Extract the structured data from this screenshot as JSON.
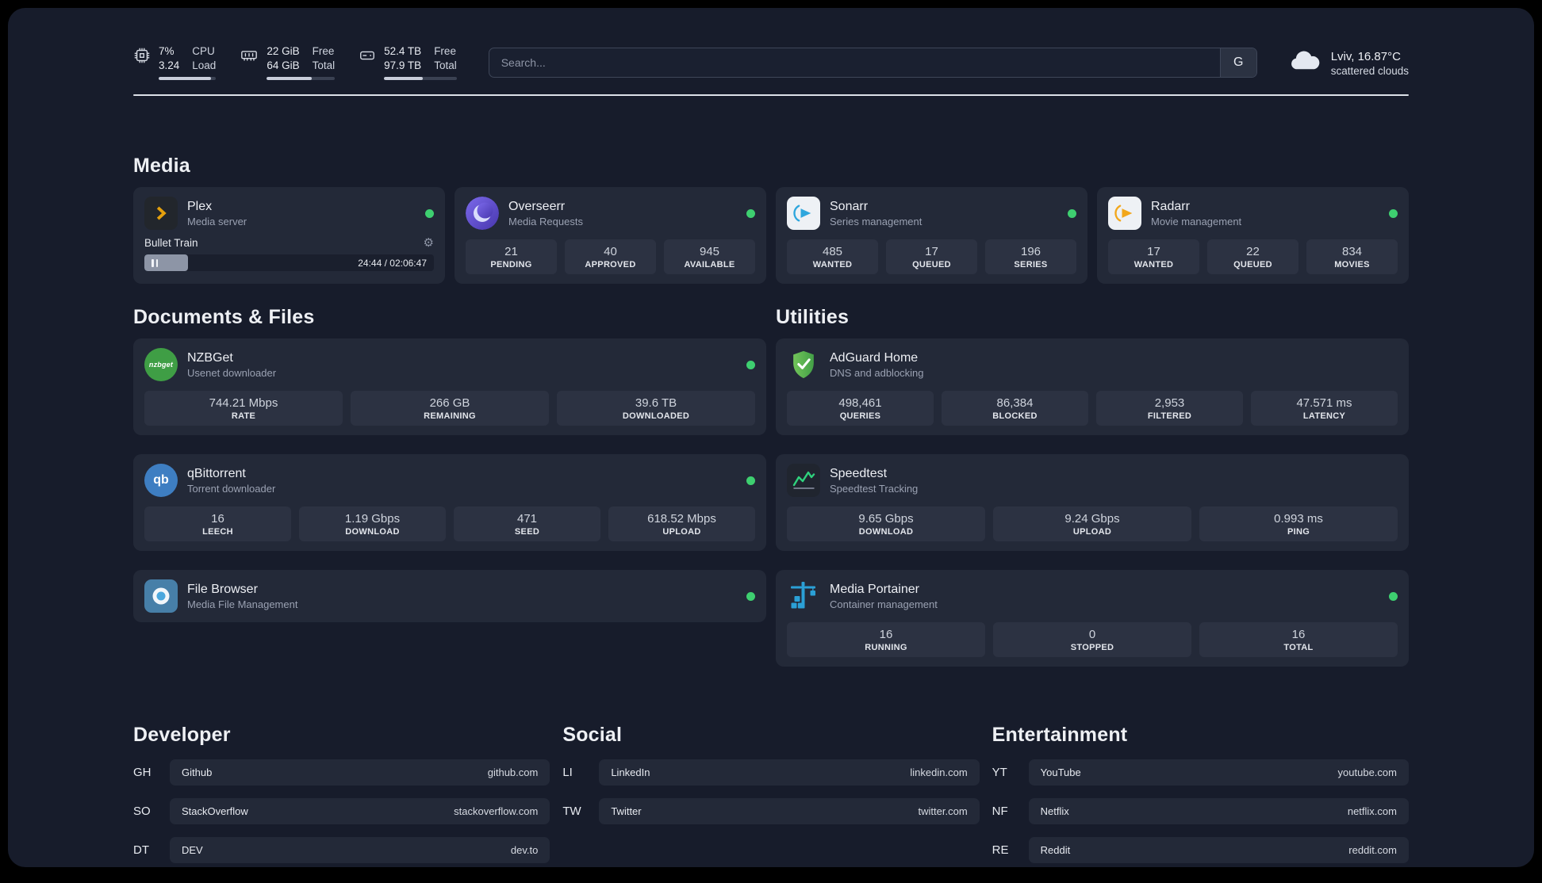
{
  "colors": {
    "status_online": "#3ecf70",
    "plex_gold": "#e5a00d",
    "sonarr_blue": "#2ea6dd",
    "radarr_amber": "#f2a71c",
    "nzbget_green": "#3f9e45",
    "qbittorrent_blue": "#3e7ec2",
    "adguard_green": "#57b85c",
    "speedtest_green": "#2fd27d",
    "portainer_blue": "#2ba0d6",
    "page_background": "#171c2b"
  },
  "icons": {
    "gear": "⚙",
    "nzbget_text": "nzbget",
    "qbittorrent_text": "qb"
  },
  "header": {
    "cpu": {
      "value_top": "7%",
      "value_bottom": "3.24",
      "label_top": "CPU",
      "label_bottom": "Load",
      "progress": 91
    },
    "ram": {
      "value_top": "22 GiB",
      "value_bottom": "64 GiB",
      "label_top": "Free",
      "label_bottom": "Total",
      "progress": 66
    },
    "disk": {
      "value_top": "52.4 TB",
      "value_bottom": "97.9 TB",
      "label_top": "Free",
      "label_bottom": "Total",
      "progress": 53
    },
    "search": {
      "placeholder": "Search...",
      "engine_button": "G"
    },
    "weather": {
      "location": "Lviv, 16.87°C",
      "condition": "scattered clouds"
    }
  },
  "media": {
    "title": "Media",
    "plex": {
      "name": "Plex",
      "desc": "Media server",
      "player": {
        "title": "Bullet Train",
        "time": "24:44 / 02:06:47",
        "progress": 15
      }
    },
    "overseerr": {
      "name": "Overseerr",
      "desc": "Media Requests",
      "stats": [
        {
          "value": "21",
          "label": "PENDING"
        },
        {
          "value": "40",
          "label": "APPROVED"
        },
        {
          "value": "945",
          "label": "AVAILABLE"
        }
      ]
    },
    "sonarr": {
      "name": "Sonarr",
      "desc": "Series management",
      "stats": [
        {
          "value": "485",
          "label": "WANTED"
        },
        {
          "value": "17",
          "label": "QUEUED"
        },
        {
          "value": "196",
          "label": "SERIES"
        }
      ]
    },
    "radarr": {
      "name": "Radarr",
      "desc": "Movie management",
      "stats": [
        {
          "value": "17",
          "label": "WANTED"
        },
        {
          "value": "22",
          "label": "QUEUED"
        },
        {
          "value": "834",
          "label": "MOVIES"
        }
      ]
    }
  },
  "documents": {
    "title": "Documents & Files",
    "nzbget": {
      "name": "NZBGet",
      "desc": "Usenet downloader",
      "stats": [
        {
          "value": "744.21 Mbps",
          "label": "RATE"
        },
        {
          "value": "266 GB",
          "label": "REMAINING"
        },
        {
          "value": "39.6 TB",
          "label": "DOWNLOADED"
        }
      ]
    },
    "qbittorrent": {
      "name": "qBittorrent",
      "desc": "Torrent downloader",
      "stats": [
        {
          "value": "16",
          "label": "LEECH"
        },
        {
          "value": "1.19 Gbps",
          "label": "DOWNLOAD"
        },
        {
          "value": "471",
          "label": "SEED"
        },
        {
          "value": "618.52 Mbps",
          "label": "UPLOAD"
        }
      ]
    },
    "filebrowser": {
      "name": "File Browser",
      "desc": "Media File Management"
    }
  },
  "utilities": {
    "title": "Utilities",
    "adguard": {
      "name": "AdGuard Home",
      "desc": "DNS and adblocking",
      "stats": [
        {
          "value": "498,461",
          "label": "QUERIES"
        },
        {
          "value": "86,384",
          "label": "BLOCKED"
        },
        {
          "value": "2,953",
          "label": "FILTERED"
        },
        {
          "value": "47.571 ms",
          "label": "LATENCY"
        }
      ]
    },
    "speedtest": {
      "name": "Speedtest",
      "desc": "Speedtest Tracking",
      "stats": [
        {
          "value": "9.65 Gbps",
          "label": "DOWNLOAD"
        },
        {
          "value": "9.24 Gbps",
          "label": "UPLOAD"
        },
        {
          "value": "0.993 ms",
          "label": "PING"
        }
      ]
    },
    "portainer": {
      "name": "Media Portainer",
      "desc": "Container management",
      "stats": [
        {
          "value": "16",
          "label": "RUNNING"
        },
        {
          "value": "0",
          "label": "STOPPED"
        },
        {
          "value": "16",
          "label": "TOTAL"
        }
      ]
    }
  },
  "bookmarks": {
    "developer": {
      "title": "Developer",
      "items": [
        {
          "abbr": "GH",
          "name": "Github",
          "url": "github.com"
        },
        {
          "abbr": "SO",
          "name": "StackOverflow",
          "url": "stackoverflow.com"
        },
        {
          "abbr": "DT",
          "name": "DEV",
          "url": "dev.to"
        }
      ]
    },
    "social": {
      "title": "Social",
      "items": [
        {
          "abbr": "LI",
          "name": "LinkedIn",
          "url": "linkedin.com"
        },
        {
          "abbr": "TW",
          "name": "Twitter",
          "url": "twitter.com"
        }
      ]
    },
    "entertainment": {
      "title": "Entertainment",
      "items": [
        {
          "abbr": "YT",
          "name": "YouTube",
          "url": "youtube.com"
        },
        {
          "abbr": "NF",
          "name": "Netflix",
          "url": "netflix.com"
        },
        {
          "abbr": "RE",
          "name": "Reddit",
          "url": "reddit.com"
        }
      ]
    }
  }
}
